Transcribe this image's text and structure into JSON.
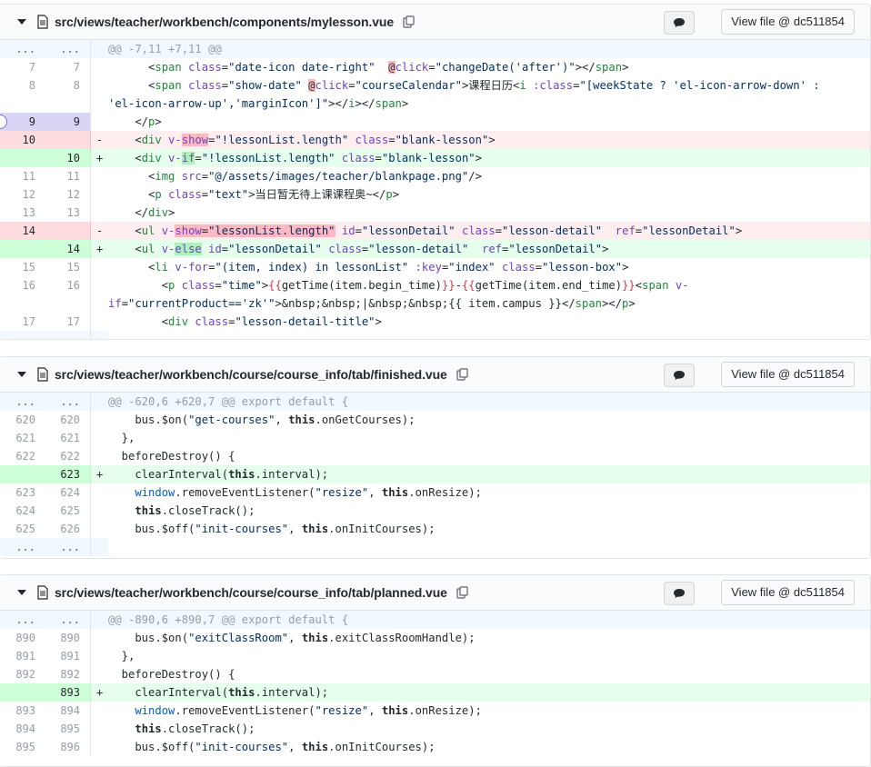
{
  "files": [
    {
      "path": "src/views/teacher/workbench/components/mylesson.vue",
      "view_label": "View file @ dc511854"
    },
    {
      "path": "src/views/teacher/workbench/course/course_info/tab/finished.vue",
      "view_label": "View file @ dc511854"
    },
    {
      "path": "src/views/teacher/workbench/course/course_info/tab/planned.vue",
      "view_label": "View file @ dc511854"
    }
  ],
  "file1_lines": {
    "hunk": "@@ -7,11 +7,11 @@",
    "l7": "7",
    "l8": "8",
    "l9": "9",
    "l10": "10",
    "l11": "11",
    "l12": "12",
    "l13": "13",
    "l14": "14",
    "l15": "15",
    "l16": "16",
    "l17": "17",
    "r7": "7",
    "r8": "8",
    "r9": "9",
    "r10": "10",
    "r11": "11",
    "r12": "12",
    "r13": "13",
    "r14": "14",
    "r15": "15",
    "r16": "16",
    "r17": "17"
  },
  "file2_lines": {
    "hunk": "@@ -620,6 +620,7 @@ export default {",
    "left": [
      "620",
      "621",
      "622",
      "",
      "623",
      "624",
      "625"
    ],
    "right": [
      "620",
      "621",
      "622",
      "623",
      "624",
      "625",
      "626"
    ]
  },
  "file3_lines": {
    "hunk": "@@ -890,6 +890,7 @@ export default {",
    "left": [
      "890",
      "891",
      "892",
      "",
      "893",
      "894",
      "895"
    ],
    "right": [
      "890",
      "891",
      "892",
      "893",
      "894",
      "895",
      "896"
    ]
  },
  "markers": {
    "ellipsis": "...",
    "minus": "-",
    "plus": "+"
  }
}
